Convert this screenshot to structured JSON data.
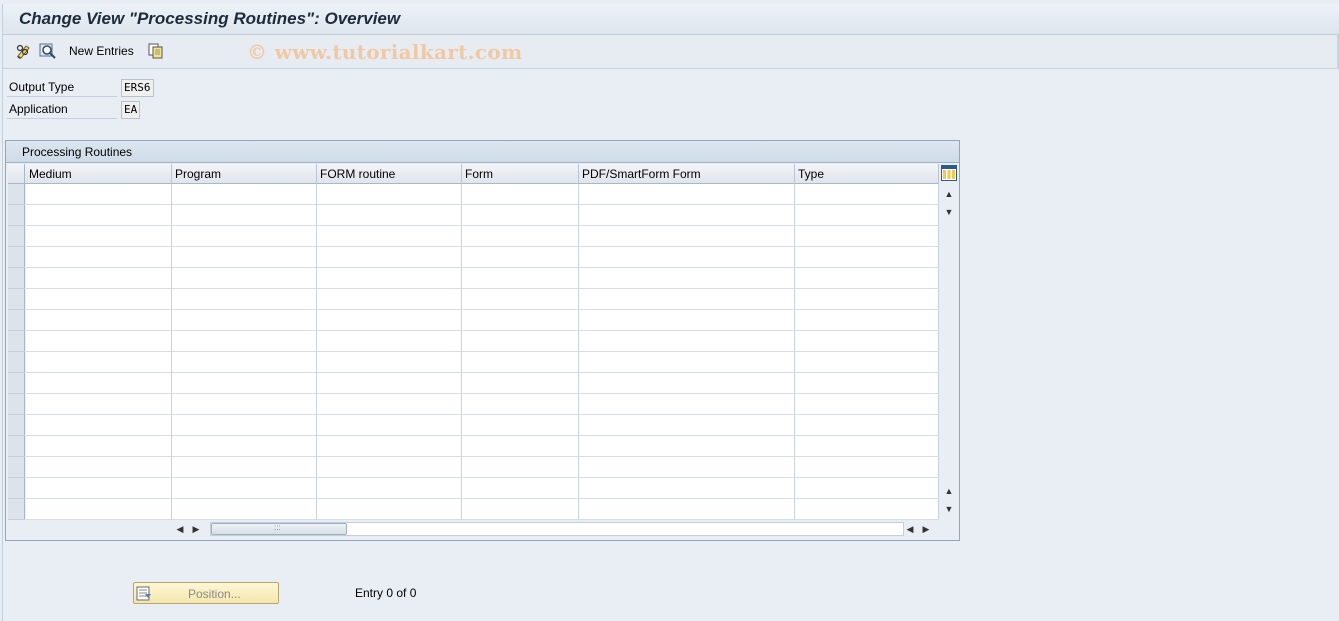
{
  "title": "Change View \"Processing Routines\": Overview",
  "toolbar": {
    "new_entries_label": "New Entries",
    "watermark": "© www.tutorialkart.com"
  },
  "fields": {
    "output_type_label": "Output Type",
    "output_type_value": "ERS6",
    "application_label": "Application",
    "application_value": "EA"
  },
  "table": {
    "caption": "Processing Routines",
    "columns": [
      "Medium",
      "Program",
      "FORM routine",
      "Form",
      "PDF/SmartForm Form",
      "Type"
    ],
    "row_count": 16
  },
  "footer": {
    "position_label": "Position...",
    "entry_text": "Entry 0 of 0"
  }
}
